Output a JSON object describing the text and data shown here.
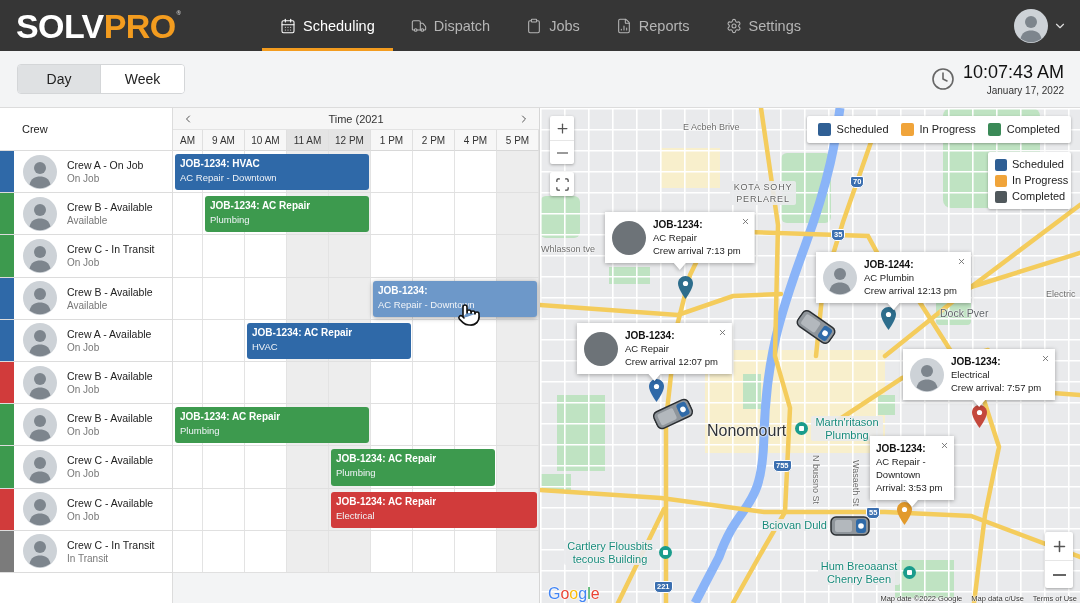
{
  "header": {
    "logo": {
      "primary": "SOLV",
      "accent": "PRO",
      "mark": "®"
    },
    "nav": [
      {
        "label": "Scheduling",
        "selected": true
      },
      {
        "label": "Dispatch",
        "selected": false
      },
      {
        "label": "Jobs",
        "selected": false
      },
      {
        "label": "Reports",
        "selected": false
      },
      {
        "label": "Settings",
        "selected": false
      }
    ]
  },
  "toolbar": {
    "view_modes": [
      {
        "label": "Day",
        "selected": true
      },
      {
        "label": "Week",
        "selected": false
      }
    ],
    "time": "10:07:43 AM",
    "date": "January 17, 2022"
  },
  "schedule": {
    "crew_heading": "Crew",
    "timeline_title": "Time (2021",
    "hours": [
      {
        "label": "AM",
        "highlighted": false,
        "shaded": false
      },
      {
        "label": "9 AM",
        "highlighted": false,
        "shaded": false
      },
      {
        "label": "10 AM",
        "highlighted": false,
        "shaded": false
      },
      {
        "label": "11 AM",
        "highlighted": true,
        "shaded": true
      },
      {
        "label": "12 PM",
        "highlighted": true,
        "shaded": true
      },
      {
        "label": "1 PM",
        "highlighted": false,
        "shaded": false
      },
      {
        "label": "2 PM",
        "highlighted": false,
        "shaded": false
      },
      {
        "label": "4 PM",
        "highlighted": false,
        "shaded": false
      },
      {
        "label": "5 PM",
        "highlighted": false,
        "shaded": true
      }
    ],
    "crews": [
      {
        "name": "Crew A - On Job",
        "status": "On Job",
        "color": "#2f69a8",
        "jobs": [
          {
            "title": "JOB-1234: HVAC",
            "detail": "AC Repair - Downtown",
            "color": "#2f69a8",
            "hovered": false
          }
        ]
      },
      {
        "name": "Crew B - Available",
        "status": "Available",
        "color": "#3d9a4e",
        "jobs": [
          {
            "title": "JOB-1234: AC Repair",
            "detail": "Plumbing",
            "color": "#3d9a4e",
            "hovered": false
          }
        ]
      },
      {
        "name": "Crew C - In Transit",
        "status": "On Job",
        "color": "#3d9a4e"
      },
      {
        "name": "Crew B - Available",
        "status": "Available",
        "color": "#2f69a8",
        "jobs": [
          {
            "title": "JOB-1234:",
            "detail": "AC Repair - Downtown",
            "color": "#6d98c9",
            "hovered": true
          }
        ]
      },
      {
        "name": "Crew A - Available",
        "status": "On Job",
        "color": "#2f69a8",
        "jobs": [
          {
            "title": "JOB-1234: AC Repair",
            "detail": "HVAC",
            "color": "#2f69a8",
            "hovered": false
          }
        ]
      },
      {
        "name": "Crew B - Available",
        "status": "On Job",
        "color": "#d13b3b"
      },
      {
        "name": "Crew B - Available",
        "status": "On Job",
        "color": "#3d9a4e",
        "jobs": [
          {
            "title": "JOB-1234: AC Repair",
            "detail": "Plumbing",
            "color": "#3d9a4e",
            "hovered": false
          }
        ]
      },
      {
        "name": "Crew C - Available",
        "status": "On Job",
        "color": "#3d9a4e",
        "jobs": [
          {
            "title": "JOB-1234: AC Repair",
            "detail": "Plumbing",
            "color": "#3d9a4e",
            "hovered": false
          }
        ]
      },
      {
        "name": "Crew C - Available",
        "status": "On Job",
        "color": "#d13b3b",
        "jobs": [
          {
            "title": "JOB-1234: AC Repair",
            "detail": "Electrical",
            "color": "#d13b3b",
            "hovered": false
          }
        ]
      },
      {
        "name": "Crew C - In Transit",
        "status": "In Transit",
        "color": "#7b7b7b"
      }
    ]
  },
  "map": {
    "legends": [
      {
        "kind": "row",
        "items": [
          {
            "label": "Scheduled",
            "color": "#2f5f94"
          },
          {
            "label": "In Progress",
            "color": "#f0a43a"
          },
          {
            "label": "Completed",
            "color": "#3a8a57"
          }
        ]
      },
      {
        "kind": "column",
        "items": [
          {
            "label": "Scheduled",
            "color": "#2f5f94"
          },
          {
            "label": "In Progress",
            "color": "#f0a43a"
          },
          {
            "label": "Completed",
            "color": "#50585c"
          }
        ]
      }
    ],
    "popups": [
      {
        "kind": "equipment",
        "title": "JOB-1234:",
        "lines": [
          "AC Repair",
          "Crew arrival 7:13 pm"
        ],
        "color": "#2d6d8c"
      },
      {
        "kind": "crew",
        "title": "JOB-1244:",
        "lines": [
          "AC Plumbin",
          "Crew arrival 12:13 pm"
        ],
        "color": "#2d6d8c"
      },
      {
        "kind": "equipment",
        "title": "JOB-1234:",
        "lines": [
          "AC Repair",
          "Crew arrival 12:07 pm"
        ],
        "color": "#2f69a8"
      },
      {
        "kind": "crew",
        "title": "JOB-1234:",
        "lines": [
          "Electrical",
          "Crew arrival: 7:57 pm"
        ],
        "color": "#c4483c"
      },
      {
        "kind": "plain",
        "title": "JOB-1234:",
        "lines": [
          "AC Repair - Downtown",
          "Arrival: 3:53 pm"
        ],
        "color": "#e29a2c"
      }
    ],
    "labels": [
      {
        "kind": "road",
        "text": "E Acbeh Brive"
      },
      {
        "kind": "district",
        "text": "KOTA SOHY PERLAREL"
      },
      {
        "kind": "road",
        "text": "Whlasson tve"
      },
      {
        "kind": "area",
        "text": "Dock Pver"
      },
      {
        "kind": "road",
        "text": "Electric"
      },
      {
        "kind": "city",
        "text": "Nonomourt"
      },
      {
        "kind": "place",
        "text": "Martn'ritason Plumbng"
      },
      {
        "kind": "cross-street",
        "text": "N bussno St"
      },
      {
        "kind": "cross-street",
        "text": "Wasaeth St"
      },
      {
        "kind": "business",
        "text": "Bciovan Duld"
      },
      {
        "kind": "place",
        "text": "Cartlery Flousbits tecous Building"
      },
      {
        "kind": "place",
        "text": "Hum Breoaanst Chenry Been"
      }
    ],
    "route_markers": [
      "70",
      "35",
      "755",
      "55",
      "221"
    ],
    "provider": "Google",
    "attribution": [
      "Map date ©2022 Google",
      "Map data c/Use",
      "Terms of Use"
    ]
  }
}
